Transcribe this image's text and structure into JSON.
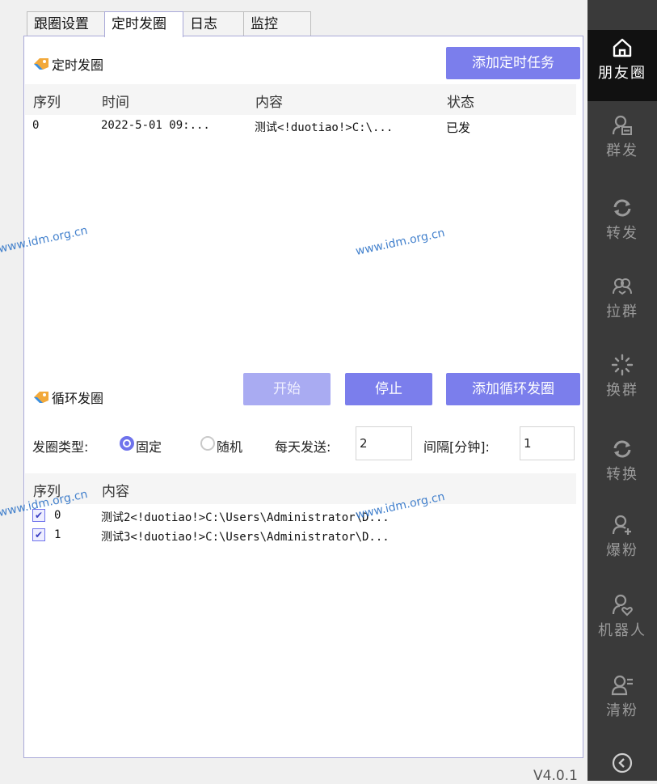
{
  "tabs": [
    "跟圈设置",
    "定时发圈",
    "日志",
    "监控"
  ],
  "active_tab": 1,
  "scheduled": {
    "title": "定时发圈",
    "add_button": "添加定时任务",
    "headers": [
      "序列",
      "时间",
      "内容",
      "状态"
    ],
    "rows": [
      {
        "seq": "0",
        "time": "2022-5-01 09:...",
        "content": "测试<!duotiao!>C:\\...",
        "status": "已发"
      }
    ]
  },
  "loop": {
    "title": "循环发圈",
    "start_button": "开始",
    "stop_button": "停止",
    "add_button": "添加循环发圈",
    "type_label": "发圈类型:",
    "option_fixed": "固定",
    "option_random": "随机",
    "daily_label": "每天发送:",
    "daily_value": "2",
    "interval_label": "间隔[分钟]:",
    "interval_value": "1",
    "headers": [
      "序列",
      "内容"
    ],
    "rows": [
      {
        "seq": "0",
        "content": "测试2<!duotiao!>C:\\Users\\Administrator\\D...",
        "checked": true
      },
      {
        "seq": "1",
        "content": "测试3<!duotiao!>C:\\Users\\Administrator\\D...",
        "checked": true
      }
    ]
  },
  "watermark": "www.idm.org.cn",
  "version": "V4.0.1",
  "sidebar": {
    "items": [
      {
        "label": "朋友圈",
        "icon": "home-icon",
        "active": true
      },
      {
        "label": "群发",
        "icon": "group-send-icon"
      },
      {
        "label": "转发",
        "icon": "refresh-icon"
      },
      {
        "label": "拉群",
        "icon": "users-icon"
      },
      {
        "label": "换群",
        "icon": "sparkle-icon"
      },
      {
        "label": "转换",
        "icon": "refresh-icon"
      },
      {
        "label": "爆粉",
        "icon": "user-plus-icon"
      },
      {
        "label": "机器人",
        "icon": "user-heart-icon"
      },
      {
        "label": "清粉",
        "icon": "user-list-icon"
      }
    ],
    "bottom_icon": "chevron-left-circle-icon"
  },
  "colors": {
    "accent": "#7b7eec",
    "sidebar": "#3a3a3a",
    "watermark": "#2f74c8"
  }
}
